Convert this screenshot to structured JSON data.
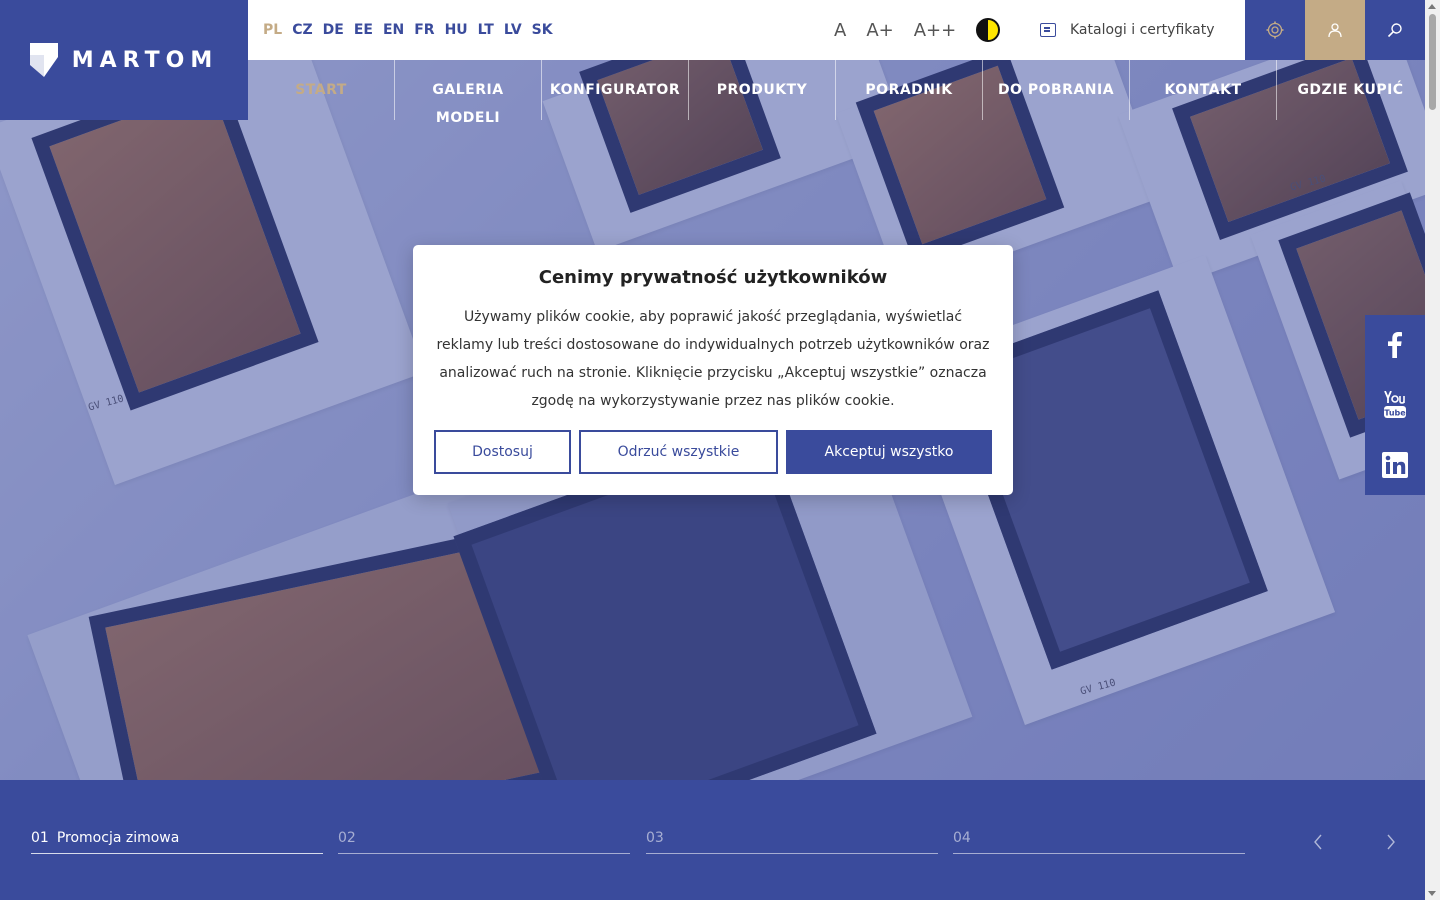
{
  "brand": {
    "logo_text": "MARTOM"
  },
  "languages": [
    {
      "code": "PL",
      "active": true
    },
    {
      "code": "CZ"
    },
    {
      "code": "DE"
    },
    {
      "code": "EE"
    },
    {
      "code": "EN"
    },
    {
      "code": "FR"
    },
    {
      "code": "HU"
    },
    {
      "code": "LT"
    },
    {
      "code": "LV"
    },
    {
      "code": "SK"
    }
  ],
  "accessibility": {
    "font_small": "A",
    "font_medium": "A+",
    "font_large": "A++",
    "contrast_icon": "contrast-icon"
  },
  "catalog": {
    "label": "Katalogi i certyfikaty",
    "icon": "catalog-icon"
  },
  "top_buttons": {
    "settings_icon": "gear-icon",
    "user_icon": "user-icon",
    "search_icon": "search-icon"
  },
  "nav": [
    {
      "label": "START",
      "active": true
    },
    {
      "label": "GALERIA MODELI"
    },
    {
      "label": "KONFIGURATOR"
    },
    {
      "label": "PRODUKTY"
    },
    {
      "label": "PORADNIK"
    },
    {
      "label": "DO POBRANIA"
    },
    {
      "label": "KONTAKT"
    },
    {
      "label": "GDZIE KUPIĆ"
    }
  ],
  "social": [
    "facebook-icon",
    "youtube-icon",
    "linkedin-icon"
  ],
  "hero": {
    "labels": [
      "GV 110",
      "GV 110",
      "GV 110"
    ]
  },
  "slider": {
    "tabs": [
      {
        "num": "01",
        "label": "Promocja zimowa",
        "active": true
      },
      {
        "num": "02",
        "label": ""
      },
      {
        "num": "03",
        "label": ""
      },
      {
        "num": "04",
        "label": ""
      }
    ]
  },
  "cookie": {
    "title": "Cenimy prywatność użytkowników",
    "text": "Używamy plików cookie, aby poprawić jakość przeglądania, wyświetlać reklamy lub treści dostosowane do indywidualnych potrzeb użytkowników oraz analizować ruch na stronie. Kliknięcie przycisku „Akceptuj wszystkie” oznacza zgodę na wykorzystywanie przez nas plików cookie.",
    "customize_label": "Dostosuj",
    "reject_label": "Odrzuć wszystkie",
    "accept_label": "Akceptuj wszystko"
  },
  "colors": {
    "brand_blue": "#3a4b9c",
    "accent_gold": "#c4ab86"
  }
}
